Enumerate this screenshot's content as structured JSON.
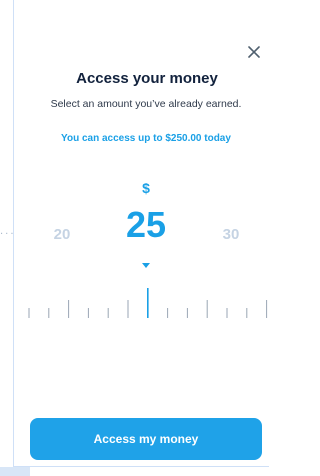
{
  "header": {
    "title": "Access your money",
    "subtitle": "Select an amount you’ve already earned.",
    "close_icon": "close-icon"
  },
  "limit": {
    "text": "You can access up to $250.00 today"
  },
  "picker": {
    "currency_symbol": "$",
    "selected_value": "25",
    "previous_value": "20",
    "next_value": "30",
    "pointer_icon": "caret-down-icon"
  },
  "ruler": {
    "ticks": [
      "minor",
      "minor",
      "mid",
      "minor",
      "minor",
      "mid",
      "major",
      "minor",
      "minor",
      "mid",
      "minor",
      "minor",
      "mid"
    ],
    "active_index": 6
  },
  "actions": {
    "primary_label": "Access my money"
  },
  "colors": {
    "accent": "#1aa0e6",
    "title": "#12223d",
    "muted": "#c5d3e3"
  }
}
